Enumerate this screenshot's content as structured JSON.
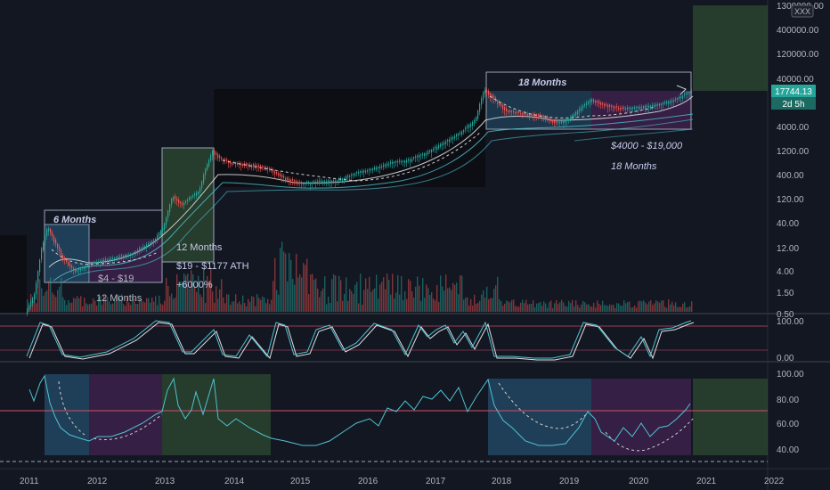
{
  "symbol_badge": "XXX",
  "price_badge": "17744.13",
  "countdown_badge": "2d 5h",
  "main_axis_ticks": [
    "1300000.00",
    "400000.00",
    "120000.00",
    "40000.00",
    "12000.00",
    "4000.00",
    "1200.00",
    "400.00",
    "120.00",
    "40.00",
    "12.00",
    "4.00",
    "1.50",
    "0.50"
  ],
  "stoch_axis_ticks": [
    "100.00",
    "0.00"
  ],
  "rsi_axis_ticks": [
    "100.00",
    "80.00",
    "60.00",
    "40.00"
  ],
  "time_axis_ticks": [
    "2011",
    "2012",
    "2013",
    "2014",
    "2015",
    "2016",
    "2017",
    "2018",
    "2019",
    "2020",
    "2021",
    "2022"
  ],
  "annotations": {
    "six_months": "6 Months",
    "range_2011": "$4 - $19",
    "twelve_months_a": "12 Months",
    "twelve_months_b": "12 Months",
    "range_2013": "$19 - $1177 ATH",
    "gain_2013": "+6000%",
    "eighteen_months_a": "18 Months",
    "range_2018": "$4000 - $19,000",
    "eighteen_months_b": "18 Months"
  },
  "colors": {
    "background": "#131722",
    "up_candle": "#26a69a",
    "down_candle": "#ef5350",
    "blue_zone": "#2f6f99",
    "purple_zone": "#6a2c78",
    "green_zone": "#3d6b3a",
    "rsi_line": "#4fc3d1",
    "stoch_k": "#4fc3d1",
    "stoch_d": "#e0e0e0",
    "rsi_ref": "#d0506a",
    "price_badge": "#26a69a"
  }
}
